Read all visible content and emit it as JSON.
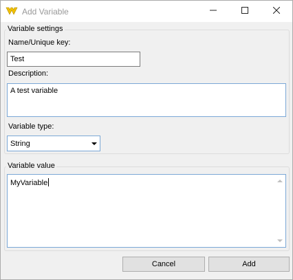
{
  "window": {
    "title": "Add Variable",
    "icons": {
      "app": "app-logo-icon",
      "minimize": "minimize-icon",
      "maximize": "maximize-icon",
      "close": "close-icon"
    }
  },
  "settings": {
    "legend": "Variable settings",
    "name_label": "Name/Unique key:",
    "name_value": "Test",
    "description_label": "Description:",
    "description_value": "A test variable",
    "type_label": "Variable type:",
    "type_selected": "String"
  },
  "value_group": {
    "legend": "Variable value",
    "value": "MyVariable"
  },
  "buttons": {
    "cancel": "Cancel",
    "add": "Add"
  },
  "colors": {
    "focus_border": "#7aa7d6",
    "button_face": "#e1e1e1",
    "dialog_bg": "#f0f0f0"
  }
}
